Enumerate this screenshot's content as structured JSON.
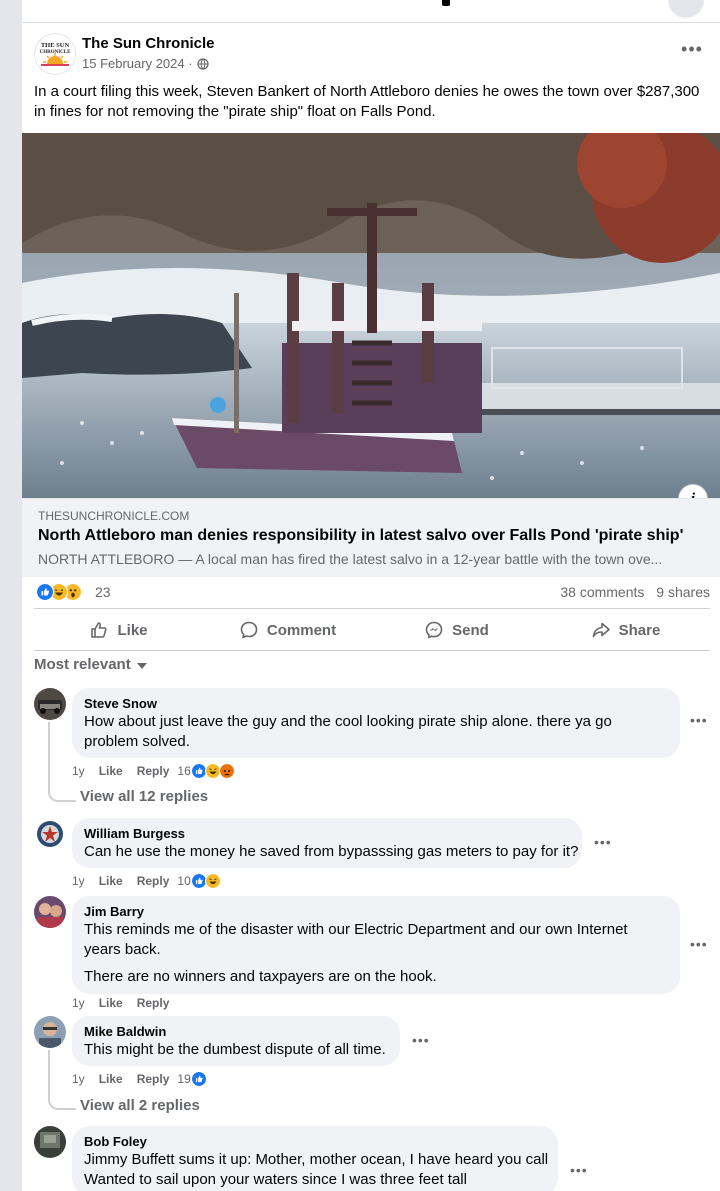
{
  "post": {
    "page_name": "The Sun Chronicle",
    "logo_text": "THE SUN CHRONICLE",
    "date": "15 February 2024 ·",
    "text": "In a court filing this week, Steven Bankert of North Attleboro denies he owes the town over $287,300 in fines for not removing the \"pirate ship\" float on Falls Pond."
  },
  "link": {
    "domain": "THESUNCHRONICLE.COM",
    "title": "North Attleboro man denies responsibility in latest salvo over Falls Pond 'pirate ship'",
    "description": "NORTH ATTLEBORO — A local man has fired the latest salvo in a 12-year battle with the town ove...",
    "info_icon": "i"
  },
  "stats": {
    "reaction_count": "23",
    "comments": "38 comments",
    "shares": "9 shares"
  },
  "actions": {
    "like": "Like",
    "comment": "Comment",
    "send": "Send",
    "share": "Share"
  },
  "sort_label": "Most relevant",
  "colors": {
    "like_blue": "#1877f2",
    "haha_yellow": "#f7b928",
    "angry_orange": "#e9710f",
    "muted_text": "#65676b",
    "bubble_bg": "#f0f2f5"
  },
  "comments": [
    {
      "name": "Steve Snow",
      "text": "How about just leave the guy and the cool looking pirate ship alone. there ya go problem solved.",
      "age": "1y",
      "like": "Like",
      "reply": "Reply",
      "reaction_count": "16",
      "view_replies": "View all 12 replies"
    },
    {
      "name": "William Burgess",
      "text": "Can he use the money he saved from bypasssing gas meters to pay for it?",
      "age": "1y",
      "like": "Like",
      "reply": "Reply",
      "reaction_count": "10"
    },
    {
      "name": "Jim Barry",
      "text1": "This reminds me of the disaster with our Electric Department and our own Internet years back.",
      "text2": "There are no winners and taxpayers are on the hook.",
      "age": "1y",
      "like": "Like",
      "reply": "Reply"
    },
    {
      "name": "Mike Baldwin",
      "text": "This might be the dumbest dispute of all time.",
      "age": "1y",
      "like": "Like",
      "reply": "Reply",
      "reaction_count": "19",
      "view_replies": "View all 2 replies"
    },
    {
      "name": "Bob Foley",
      "text1": "Jimmy Buffett sums it up: Mother, mother ocean, I have heard you call",
      "text2": "Wanted to sail upon your waters since I was three feet tall"
    }
  ]
}
